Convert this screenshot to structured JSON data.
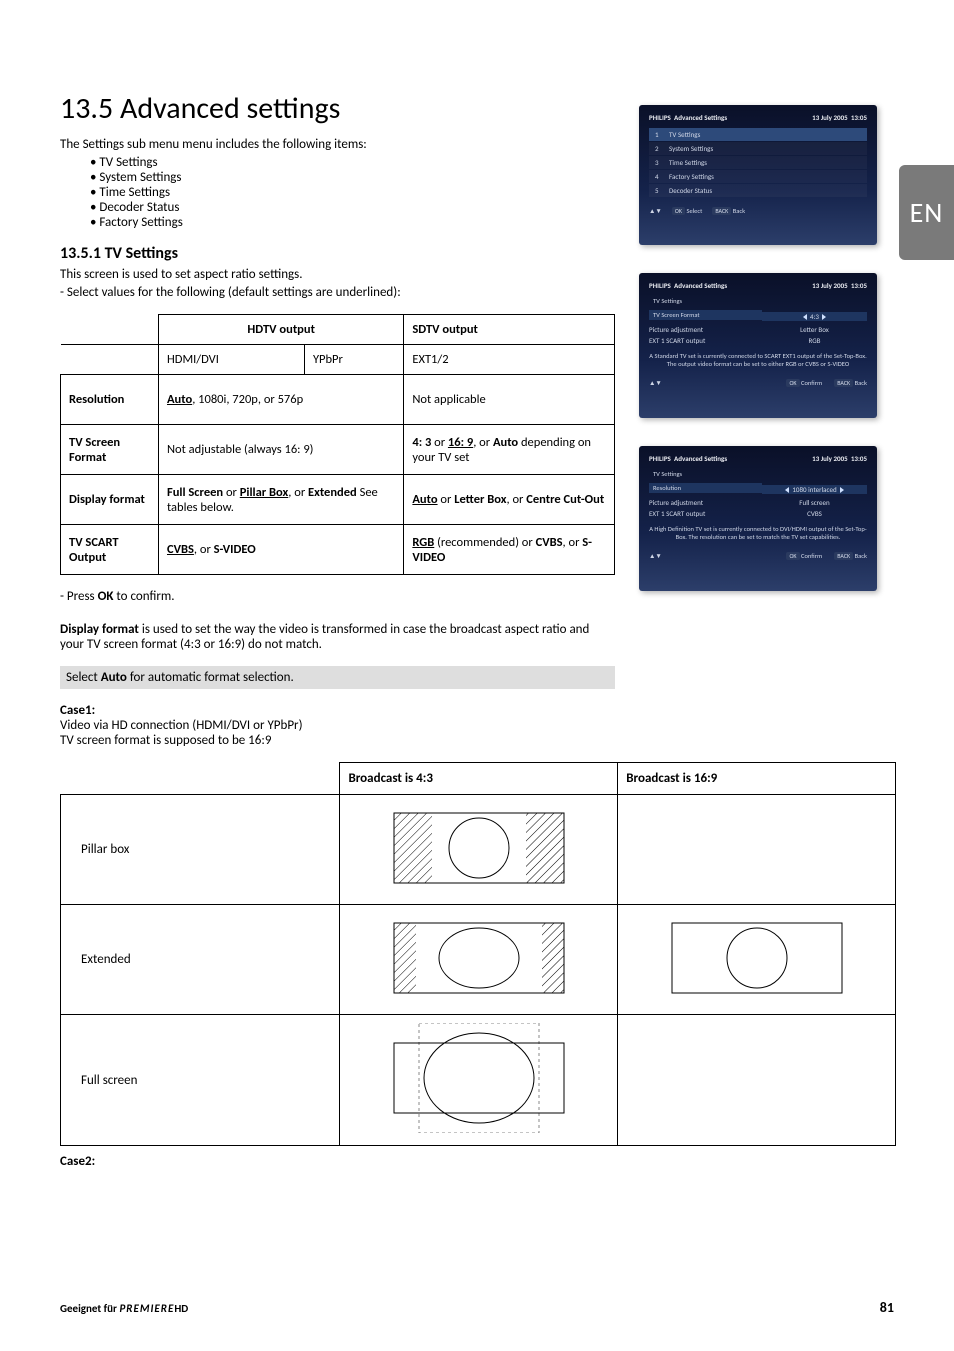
{
  "lang_tab": "EN",
  "section": {
    "number": "13.5",
    "title": "Advanced settings",
    "intro": "The Settings sub menu menu includes the following items:",
    "bullets": [
      "TV Settings",
      "System Settings",
      "Time Settings",
      "Decoder Status",
      "Factory Settings"
    ]
  },
  "sub": {
    "number": "13.5.1",
    "title": "TV Settings",
    "line1": "This screen is used to set aspect ratio settings.",
    "line2": "- Select values for the following (default settings are underlined):"
  },
  "settings_table": {
    "head": {
      "hdtv": "HDTV output",
      "sdtv": "SDTV output"
    },
    "sub": {
      "hdmi": "HDMI/DVI",
      "ypbpr": "YPbPr",
      "ext": "EXT1/2"
    },
    "rows": {
      "resolution": {
        "label": "Resolution",
        "hdtv_pre": "Auto",
        "hdtv_rest": ", 1080i, 720p, or 576p",
        "sdtv": "Not applicable"
      },
      "tvformat": {
        "label": "TV Screen Format",
        "hdtv": "Not adjustable (always 16: 9)",
        "sdtv_a": "4: 3",
        "sdtv_b": "16: 9",
        "sdtv_c": "Auto",
        "sdtv_rest": " depending on your TV set"
      },
      "display": {
        "label": "Display format",
        "hdtv_a": "Full Screen",
        "hdtv_b": "Pillar Box",
        "hdtv_c": "Extended",
        "hdtv_rest": " See tables below.",
        "sdtv_a": "Auto",
        "sdtv_b": "Letter Box",
        "sdtv_c": "Centre Cut-Out"
      },
      "scart": {
        "label": "TV SCART Output",
        "hdtv_a": "CVBS",
        "hdtv_b": "S-VIDEO",
        "sdtv_a": "RGB",
        "sdtv_rec": " (recommended) or ",
        "sdtv_b": "CVBS",
        "sdtv_c": "S-VIDEO"
      }
    }
  },
  "after": {
    "confirm": "- Press ",
    "confirm_b": "OK",
    "confirm2": " to confirm.",
    "df1a": "Display format",
    "df1b": " is used to set the way the video is transformed in case the broadcast aspect ratio and your TV screen format (4:3 or 16:9) do not match.",
    "note_a": "Select ",
    "note_b": "Auto",
    "note_c": " for automatic format selection."
  },
  "case1": {
    "title": "Case1:",
    "l1": "Video via HD connection (HDMI/DVI or YPbPr)",
    "l2": "TV screen format is supposed to be 16:9"
  },
  "format_table": {
    "head": {
      "b43": "Broadcast is 4:3",
      "b169": "Broadcast is 16:9"
    },
    "rows": [
      "Pillar box",
      "Extended",
      "Full screen"
    ]
  },
  "case2": "Case2:",
  "footer": {
    "geeignet": "Geeignet für ",
    "brand": "PREMIERE",
    "hd": "HD",
    "page": "81"
  },
  "shots": {
    "brand": "PHILIPS",
    "title": "Advanced Settings",
    "date": "13 July 2005",
    "time": "13:05",
    "nav_updown": "▲▼",
    "btn_ok": "OK",
    "btn_back": "BACK",
    "lbl_select": "Select",
    "lbl_back": "Back",
    "lbl_confirm": "Confirm",
    "shot1_items": [
      {
        "n": "1",
        "t": "TV Settings"
      },
      {
        "n": "2",
        "t": "System Settings"
      },
      {
        "n": "3",
        "t": "Time Settings"
      },
      {
        "n": "4",
        "t": "Factory Settings"
      },
      {
        "n": "5",
        "t": "Decoder Status"
      }
    ],
    "shot2": {
      "sub": "TV Settings",
      "rows": [
        {
          "l": "TV Screen Format",
          "v": "4:3",
          "sel": true
        },
        {
          "l": "Picture adjustment",
          "v": "Letter Box"
        },
        {
          "l": "EXT 1 SCART output",
          "v": "RGB"
        }
      ],
      "msg": "A Standard TV set is currently connected to SCART EXT1 output of the Set-Top-Box. The output video format can be set to either RGB or CVBS or S-VIDEO"
    },
    "shot3": {
      "sub": "TV Settings",
      "rows": [
        {
          "l": "Resolution",
          "v": "1080 interlaced",
          "sel": true
        },
        {
          "l": "Picture adjustment",
          "v": "Full screen"
        },
        {
          "l": "EXT 1 SCART output",
          "v": "CVBS"
        }
      ],
      "msg": "A High Definition TV set is currently connected to DVI/HDMI output of the Set-Top-Box. The resolution can be set to match the TV set capabilities."
    }
  }
}
